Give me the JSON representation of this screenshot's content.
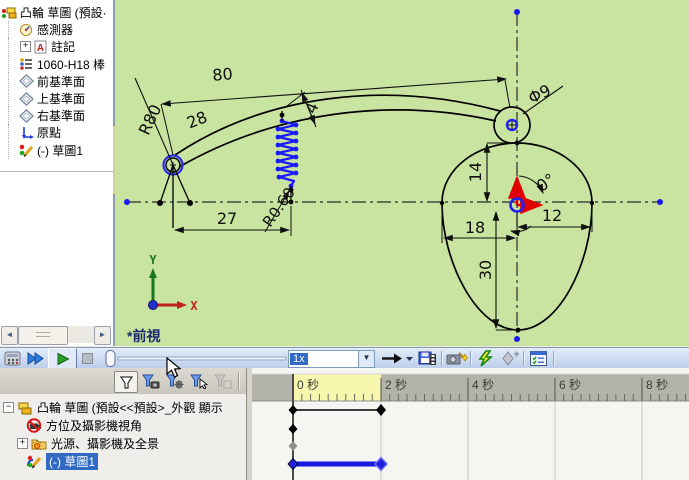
{
  "feature_tree": {
    "root_label": "凸輪 草圖 (預設·",
    "items": [
      {
        "label": "感測器",
        "icon": "sensors-icon"
      },
      {
        "label": "註記",
        "icon": "annotations-icon"
      },
      {
        "label": "1060-H18 棒",
        "icon": "material-icon"
      },
      {
        "label": "前基準面",
        "icon": "plane-icon"
      },
      {
        "label": "上基準面",
        "icon": "plane-icon"
      },
      {
        "label": "右基準面",
        "icon": "plane-icon"
      },
      {
        "label": "原點",
        "icon": "origin-icon"
      },
      {
        "label": "(-) 草圖1",
        "icon": "sketch-icon"
      }
    ]
  },
  "viewport": {
    "view_label": "*前視",
    "triad_x": "X",
    "triad_y": "Y"
  },
  "dims": {
    "len80": "80",
    "rad80": "R80",
    "len28": "28",
    "len4": "4",
    "rad060": "R0.60",
    "len27": "27",
    "dia9": "Φ9",
    "len14": "14",
    "ang0": "0°",
    "len12": "12",
    "len18": "18",
    "len30": "30"
  },
  "motion_toolbar": {
    "speed": "1x"
  },
  "motion_tree": {
    "root_label": "凸輪 草圖 (預設<<預設>_外觀 顯示",
    "items": [
      {
        "label": "方位及攝影機視角",
        "icon": "camera-disabled-icon"
      },
      {
        "label": "光源、攝影機及全景",
        "icon": "lights-folder-icon"
      },
      {
        "label": "(-) 草圖1",
        "icon": "sketch-icon",
        "selected": true
      }
    ]
  },
  "timeline": {
    "ticks": [
      "0 秒",
      "2 秒",
      "4 秒",
      "6 秒",
      "8 秒"
    ],
    "keyframe_times_s": [
      0,
      2
    ],
    "selected_row": "(-) 草圖1",
    "accent_blue": "#1818e0",
    "ruler_highlight": "#f7f7b0"
  }
}
